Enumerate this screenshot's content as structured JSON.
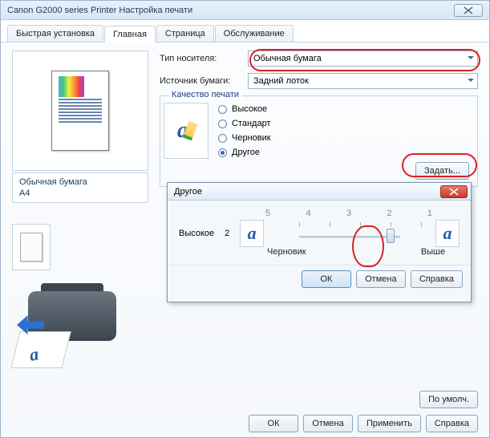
{
  "window_title": "Canon G2000 series Printer Настройка печати",
  "tabs": [
    "Быстрая установка",
    "Главная",
    "Страница",
    "Обслуживание"
  ],
  "active_tab": 1,
  "labels": {
    "media_type": "Тип носителя:",
    "source": "Источник бумаги:",
    "quality_legend": "Качество печати"
  },
  "selects": {
    "media_type": "Обычная бумага",
    "source": "Задний лоток"
  },
  "quality_options": [
    "Высокое",
    "Стандарт",
    "Черновик",
    "Другое"
  ],
  "quality_selected": "Другое",
  "set_button": "Задать...",
  "info": {
    "media": "Обычная бумага",
    "size": "A4"
  },
  "modal": {
    "title": "Другое",
    "left_label": "Высокое",
    "left_val": "2",
    "ticks": [
      "5",
      "4",
      "3",
      "2",
      "1"
    ],
    "slider_value": 2,
    "low_label": "Черновик",
    "high_label": "Выше",
    "buttons": {
      "ok": "ОК",
      "cancel": "Отмена",
      "help": "Справка"
    }
  },
  "defaults_button": "По умолч.",
  "footer": {
    "ok": "ОК",
    "cancel": "Отмена",
    "apply": "Применить",
    "help": "Справка"
  }
}
